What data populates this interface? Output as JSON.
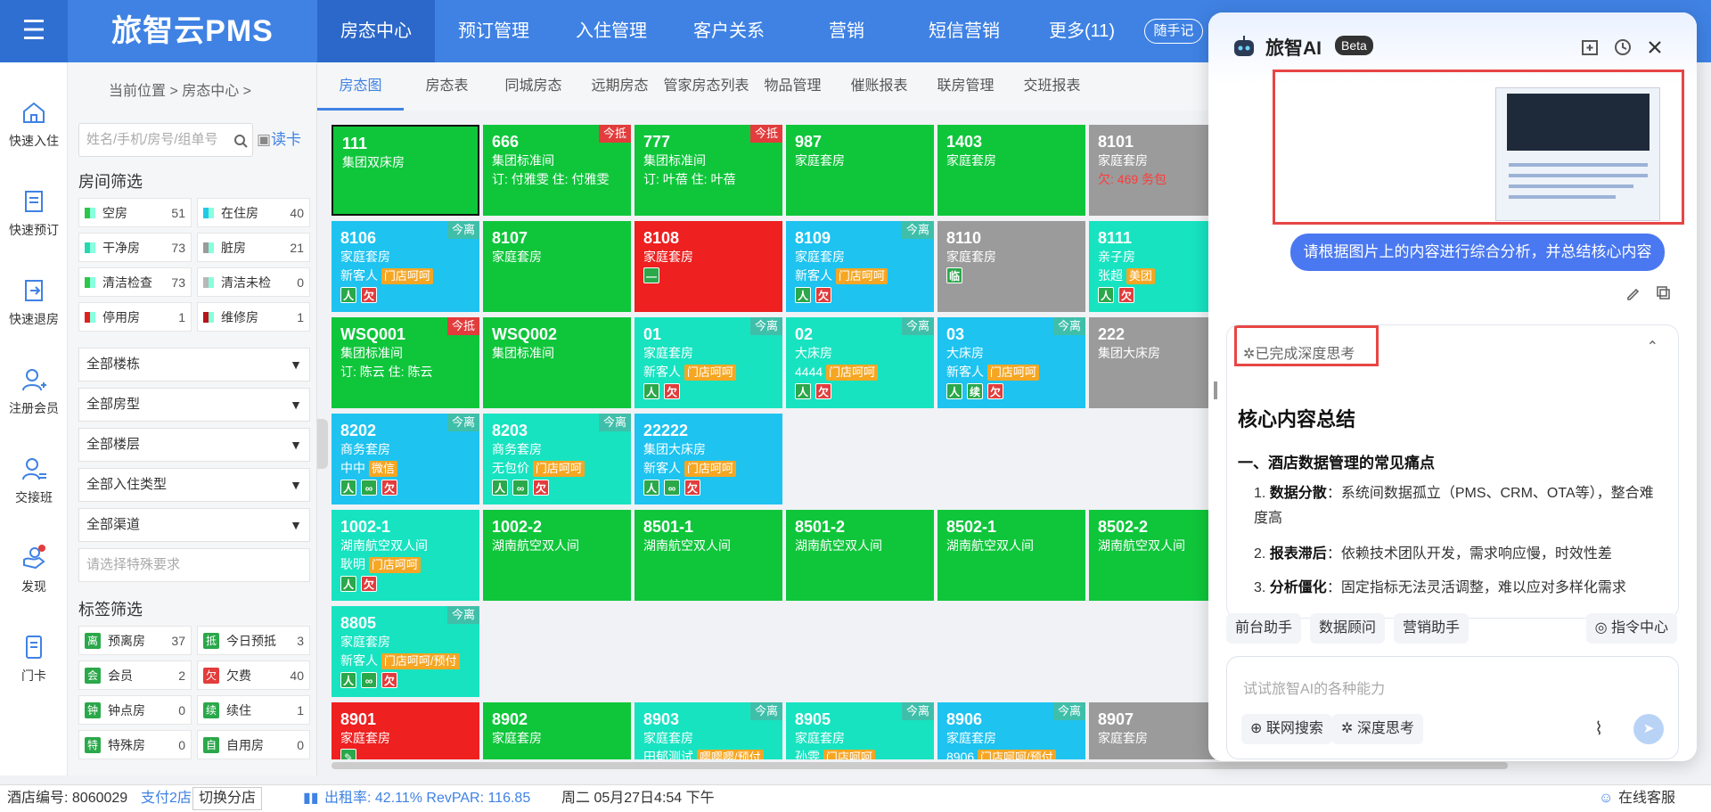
{
  "app": {
    "brand": "旅智云PMS",
    "menu_icon": "menu-icon"
  },
  "nav": [
    {
      "label": "房态中心"
    },
    {
      "label": "预订管理"
    },
    {
      "label": "入住管理"
    },
    {
      "label": "客户关系"
    },
    {
      "label": "营销"
    },
    {
      "label": "短信营销"
    },
    {
      "label": "更多(11)"
    }
  ],
  "quick_note": "随手记",
  "left_rail": [
    {
      "label": "快速入住",
      "icon": "home-icon"
    },
    {
      "label": "快速预订",
      "icon": "book-icon"
    },
    {
      "label": "快速退房",
      "icon": "checkout-icon"
    },
    {
      "label": "注册会员",
      "icon": "user-add-icon"
    },
    {
      "label": "交接班",
      "icon": "shift-icon"
    },
    {
      "label": "发现",
      "icon": "discover-icon"
    },
    {
      "label": "门卡",
      "icon": "card-icon"
    }
  ],
  "breadcrumb": "当前位置 > 房态中心 >",
  "search": {
    "placeholder": "姓名/手机/房号/组单号",
    "read_card": "读卡"
  },
  "room_filter": {
    "title": "房间筛选",
    "items": [
      {
        "label": "空房",
        "count": "51",
        "color": "#2fc44a"
      },
      {
        "label": "在住房",
        "count": "40",
        "color": "#23c9e6"
      },
      {
        "label": "干净房",
        "count": "73",
        "color": "#27d7b2"
      },
      {
        "label": "脏房",
        "count": "21",
        "color": "#9b9b9b"
      },
      {
        "label": "清洁检查",
        "count": "73",
        "color": "#2fc44a"
      },
      {
        "label": "清洁未检",
        "count": "0",
        "color": "#b8b8b8"
      },
      {
        "label": "停用房",
        "count": "1",
        "color": "#e02020"
      },
      {
        "label": "维修房",
        "count": "1",
        "color": "#b8141a"
      }
    ]
  },
  "dropdowns": [
    "全部楼栋",
    "全部房型",
    "全部楼层",
    "全部入住类型",
    "全部渠道"
  ],
  "special_req_placeholder": "请选择特殊要求",
  "tag_filter": {
    "title": "标签筛选",
    "items": [
      {
        "badge": "离",
        "label": "预离房",
        "count": "37",
        "color": "#2aa84a"
      },
      {
        "badge": "抵",
        "label": "今日预抵",
        "count": "3",
        "color": "#2aa84a"
      },
      {
        "badge": "会",
        "label": "会员",
        "count": "2",
        "color": "#2aa84a"
      },
      {
        "badge": "欠",
        "label": "欠费",
        "count": "40",
        "color": "#e23c3c"
      },
      {
        "badge": "钟",
        "label": "钟点房",
        "count": "0",
        "color": "#2aa84a"
      },
      {
        "badge": "续",
        "label": "续住",
        "count": "1",
        "color": "#2aa84a"
      },
      {
        "badge": "特",
        "label": "特殊房",
        "count": "0",
        "color": "#2aa84a"
      },
      {
        "badge": "自",
        "label": "自用房",
        "count": "0",
        "color": "#2aa84a"
      }
    ]
  },
  "sub_tabs": [
    "房态图",
    "房态表",
    "同城房态",
    "远期房态",
    "管家房态列表",
    "物品管理",
    "催账报表",
    "联房管理",
    "交班报表"
  ],
  "rooms": [
    {
      "no": "111",
      "type": "集团双床房",
      "line3": "",
      "tag": "",
      "corner": "",
      "color": "#0fc63b",
      "selected": true,
      "icons": []
    },
    {
      "no": "666",
      "type": "集团标准间",
      "line3": "订: 付雅雯 住: 付雅雯",
      "tag": "",
      "corner": "今抵",
      "color": "#0fc63b",
      "icons": []
    },
    {
      "no": "777",
      "type": "集团标准间",
      "line3": "订: 叶蓓 住: 叶蓓",
      "tag": "",
      "corner": "今抵",
      "color": "#0fc63b",
      "icons": []
    },
    {
      "no": "987",
      "type": "家庭套房",
      "line3": "",
      "tag": "",
      "corner": "",
      "color": "#0fc63b",
      "icons": []
    },
    {
      "no": "1403",
      "type": "家庭套房",
      "line3": "",
      "tag": "",
      "corner": "",
      "color": "#0fc63b",
      "icons": []
    },
    {
      "no": "8101",
      "type": "家庭套房",
      "line3": "欠: 469 务包",
      "tag": "",
      "corner": "",
      "color": "#9b9b9b",
      "icons": []
    },
    {
      "no": "8106",
      "type": "家庭套房",
      "line3": "新客人",
      "tag": "门店呵呵",
      "corner": "今离",
      "color": "#1ec3f0",
      "icons": [
        "人",
        "欠"
      ]
    },
    {
      "no": "8107",
      "type": "家庭套房",
      "line3": "",
      "tag": "",
      "corner": "",
      "color": "#0fc63b",
      "icons": []
    },
    {
      "no": "8108",
      "type": "家庭套房",
      "line3": "",
      "tag": "",
      "corner": "",
      "color": "#ee2020",
      "icons": [
        "—"
      ]
    },
    {
      "no": "8109",
      "type": "家庭套房",
      "line3": "新客人",
      "tag": "门店呵呵",
      "corner": "今离",
      "color": "#1ec3f0",
      "icons": [
        "人",
        "欠"
      ]
    },
    {
      "no": "8110",
      "type": "家庭套房",
      "line3": "",
      "tag": "",
      "corner": "",
      "color": "#9b9b9b",
      "icons": [
        "临"
      ]
    },
    {
      "no": "8111",
      "type": "亲子房",
      "line3": "张超",
      "tag": "美团",
      "corner": "",
      "color": "#17e3c1",
      "icons": [
        "人",
        "欠"
      ]
    },
    {
      "no": "WSQ001",
      "type": "集团标准间",
      "line3": "订: 陈云 住: 陈云",
      "tag": "",
      "corner": "今抵",
      "color": "#0fc63b",
      "icons": []
    },
    {
      "no": "WSQ002",
      "type": "集团标准间",
      "line3": "",
      "tag": "",
      "corner": "",
      "color": "#0fc63b",
      "icons": []
    },
    {
      "no": "01",
      "type": "家庭套房",
      "line3": "新客人",
      "tag": "门店呵呵",
      "corner": "今离",
      "color": "#17e3c1",
      "icons": [
        "人",
        "欠"
      ]
    },
    {
      "no": "02",
      "type": "大床房",
      "line3": "4444",
      "tag": "门店呵呵",
      "corner": "今离",
      "color": "#17e3c1",
      "icons": [
        "人",
        "欠"
      ]
    },
    {
      "no": "03",
      "type": "大床房",
      "line3": "新客人",
      "tag": "门店呵呵",
      "corner": "今离",
      "color": "#1ec3f0",
      "icons": [
        "人",
        "续",
        "欠"
      ]
    },
    {
      "no": "222",
      "type": "集团大床房",
      "line3": "",
      "tag": "",
      "corner": "",
      "color": "#9b9b9b",
      "icons": []
    },
    {
      "no": "8202",
      "type": "商务套房",
      "line3": "中中",
      "tag": "微信",
      "corner": "今离",
      "color": "#1ec3f0",
      "icons": [
        "人",
        "∞",
        "欠"
      ]
    },
    {
      "no": "8203",
      "type": "商务套房",
      "line3": "无包价",
      "tag": "门店呵呵",
      "corner": "今离",
      "color": "#17e3c1",
      "icons": [
        "人",
        "∞",
        "欠"
      ]
    },
    {
      "no": "22222",
      "type": "集团大床房",
      "line3": "新客人",
      "tag": "门店呵呵",
      "corner": "",
      "color": "#1ec3f0",
      "icons": [
        "人",
        "∞",
        "欠"
      ]
    },
    {
      "no": "1002-1",
      "type": "湖南航空双人间",
      "line3": "耿明",
      "tag": "门店呵呵",
      "corner": "",
      "color": "#17e3c1",
      "icons": [
        "人",
        "欠"
      ]
    },
    {
      "no": "1002-2",
      "type": "湖南航空双人间",
      "line3": "",
      "tag": "",
      "corner": "",
      "color": "#0fc63b",
      "icons": []
    },
    {
      "no": "8501-1",
      "type": "湖南航空双人间",
      "line3": "",
      "tag": "",
      "corner": "",
      "color": "#0fc63b",
      "icons": []
    },
    {
      "no": "8501-2",
      "type": "湖南航空双人间",
      "line3": "",
      "tag": "",
      "corner": "",
      "color": "#0fc63b",
      "icons": []
    },
    {
      "no": "8502-1",
      "type": "湖南航空双人间",
      "line3": "",
      "tag": "",
      "corner": "",
      "color": "#0fc63b",
      "icons": []
    },
    {
      "no": "8502-2",
      "type": "湖南航空双人间",
      "line3": "",
      "tag": "",
      "corner": "",
      "color": "#0fc63b",
      "icons": []
    },
    {
      "no": "8805",
      "type": "家庭套房",
      "line3": "新客人",
      "tag": "门店呵呵/预付",
      "corner": "今离",
      "color": "#17e3c1",
      "icons": [
        "人",
        "∞",
        "欠"
      ]
    },
    {
      "no": "8901",
      "type": "家庭套房",
      "line3": "",
      "tag": "",
      "corner": "",
      "color": "#ee2020",
      "icons": [
        "✎"
      ]
    },
    {
      "no": "8902",
      "type": "家庭套房",
      "line3": "",
      "tag": "",
      "corner": "",
      "color": "#0fc63b",
      "icons": []
    },
    {
      "no": "8903",
      "type": "家庭套房",
      "line3": "田郁测试",
      "tag": "嘤嘤嘤/预付",
      "corner": "今离",
      "color": "#17e3c1",
      "icons": []
    },
    {
      "no": "8905",
      "type": "家庭套房",
      "line3": "孙雯",
      "tag": "门店呵呵",
      "corner": "今离",
      "color": "#17e3c1",
      "icons": []
    },
    {
      "no": "8906",
      "type": "家庭套房",
      "line3": "8906",
      "tag": "门店呵呵/预付",
      "corner": "今离",
      "color": "#1ec3f0",
      "icons": []
    },
    {
      "no": "8907",
      "type": "家庭套房",
      "line3": "",
      "tag": "",
      "corner": "",
      "color": "#9b9b9b",
      "icons": []
    }
  ],
  "statusbar": {
    "hotel_no_label": "酒店编号: 8060029",
    "branches": "支付2店",
    "switch": "切换分店",
    "occupancy": "出租率: 42.11% RevPAR: 116.85",
    "datetime": "周二 05月27日4:54 下午",
    "service": "在线客服"
  },
  "ai": {
    "title": "旅智AI",
    "beta": "Beta",
    "user_message": "请根据图片上的内容进行综合分析，并总结核心内容",
    "thinking": "已完成深度思考",
    "heading": "核心内容总结",
    "section": "一、酒店数据管理的常见痛点",
    "points": [
      {
        "n": "1.",
        "b": "数据分散",
        "t": "：系统间数据孤立（PMS、CRM、OTA等），整合难度高"
      },
      {
        "n": "2.",
        "b": "报表滞后",
        "t": "：依赖技术团队开发，需求响应慢，时效性差"
      },
      {
        "n": "3.",
        "b": "分析僵化",
        "t": "：固定指标无法灵活调整，难以应对多样化需求"
      }
    ],
    "chips": [
      "前台助手",
      "数据顾问",
      "营销助手"
    ],
    "command_center": "指令中心",
    "input_placeholder": "试试旅智AI的各种能力",
    "web_search": "联网搜索",
    "deep_think": "深度思考"
  }
}
